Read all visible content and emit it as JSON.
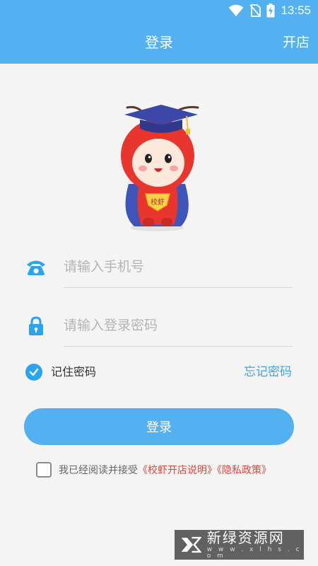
{
  "status_bar": {
    "time": "13:55",
    "icons": [
      "wifi-icon",
      "no-sim-icon",
      "battery-charging-icon"
    ]
  },
  "app_bar": {
    "title": "登录",
    "right_link": "开店"
  },
  "mascot": {
    "badge_text": "校虾"
  },
  "form": {
    "phone": {
      "placeholder": "请输入手机号",
      "value": "",
      "icon": "telephone-icon"
    },
    "password": {
      "placeholder": "请输入登录密码",
      "value": "",
      "icon": "lock-icon"
    },
    "remember_label": "记住密码",
    "remember_checked": true,
    "forgot_link": "忘记密码",
    "login_button": "登录"
  },
  "agreement": {
    "checked": false,
    "prefix": "我已经阅读并接受",
    "link1": "《校虾开店说明》",
    "link2": "《隐私政策》"
  },
  "watermark": {
    "name": "新绿资源网",
    "domain": "w w w . x l h s . c o m"
  },
  "colors": {
    "primary": "#53b1f1",
    "link": "#41a4e6",
    "agreement_link": "#e6433a",
    "background": "#f4f4f4"
  }
}
